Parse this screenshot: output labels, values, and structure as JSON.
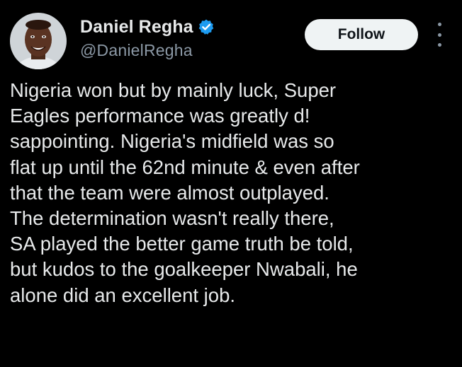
{
  "author": {
    "display_name": "Daniel Regha",
    "handle": "@DanielRegha",
    "verified": true,
    "avatar_icon": "profile-photo"
  },
  "actions": {
    "follow_label": "Follow",
    "more_icon": "vertical-ellipsis-icon"
  },
  "tweet": {
    "lines": [
      "Nigeria won but by mainly luck, Super",
      "Eagles performance was greatly d!",
      "sappointing. Nigeria's midfield was so",
      "flat up until the 62nd minute & even after",
      "that the team were almost outplayed.",
      "The determination wasn't really there,",
      "SA played the better game truth be told,",
      "but kudos to the goalkeeper Nwabali, he",
      "alone did an excellent job."
    ]
  },
  "colors": {
    "background": "#000000",
    "text_primary": "#e7e9ea",
    "text_secondary": "#8b98a5",
    "verified_badge": "#1d9bf0",
    "follow_button_bg": "#eff3f4",
    "follow_button_text": "#0f1419"
  }
}
